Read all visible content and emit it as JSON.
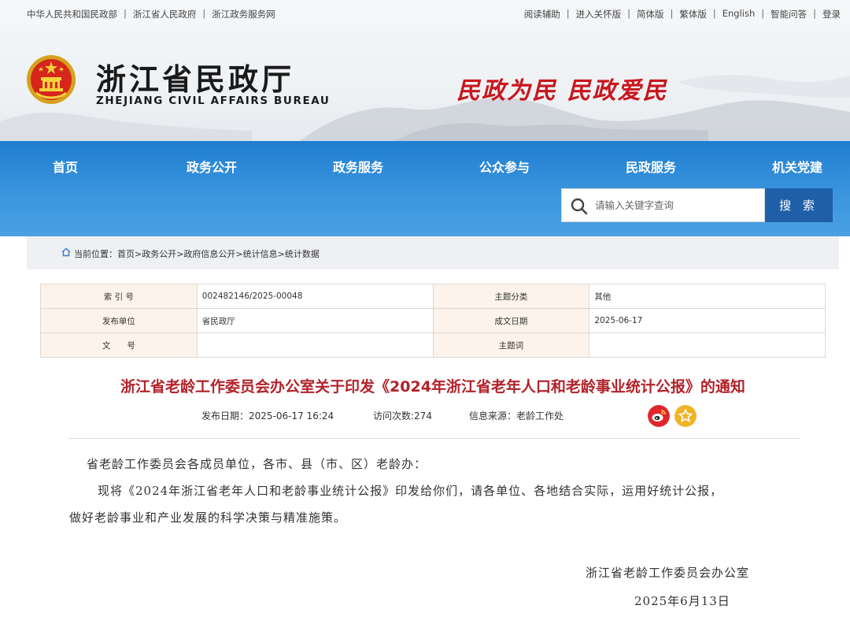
{
  "topbar": {
    "left_links": [
      "中华人民共和国民政部",
      "浙江省人民政府",
      "浙江政务服务网"
    ],
    "right_links": [
      "阅读辅助",
      "进入关怀版",
      "简体版",
      "繁体版",
      "English",
      "智能问答",
      "登录"
    ]
  },
  "header": {
    "title": "浙江省民政厅",
    "subtitle": "ZHEJIANG CIVIL AFFAIRS BUREAU",
    "slogan": "民政为民  民政爱民"
  },
  "nav": {
    "items": [
      "首页",
      "政务公开",
      "政务服务",
      "公众参与",
      "民政服务",
      "机关党建"
    ]
  },
  "search": {
    "placeholder": "请输入关键字查询",
    "button_label": "搜 索"
  },
  "breadcrumb": {
    "prefix": "当前位置：",
    "path": "首页>政务公开>政府信息公开>统计信息>统计数据"
  },
  "meta": {
    "rows": [
      {
        "k1": "索 引 号",
        "v1": "002482146/2025-00048",
        "k2": "主题分类",
        "v2": "其他"
      },
      {
        "k1": "发布单位",
        "v1": "省民政厅",
        "k2": "成文日期",
        "v2": "2025-06-17"
      },
      {
        "k1": "文　　号",
        "v1": "",
        "k2": "主题词",
        "v2": ""
      }
    ]
  },
  "article": {
    "title": "浙江省老龄工作委员会办公室关于印发《2024年浙江省老年人口和老龄事业统计公报》的通知",
    "publish_date": "发布日期：2025-06-17 16:24",
    "visits": "访问次数:274",
    "source": "信息来源：老龄工作处",
    "salutation": "省老龄工作委员会各成员单位，各市、县（市、区）老龄办：",
    "para1_line1": "现将《2024年浙江省老年人口和老龄事业统计公报》印发给你们，请各单位、各地结合实际，运用好统计公报，",
    "para1_line2": "做好老龄事业和产业发展的科学决策与精准施策。",
    "signature": "浙江省老龄工作委员会办公室",
    "sign_date": "2025年6月13日"
  },
  "icons": {
    "weibo": "weibo-icon",
    "favorite": "star-icon",
    "search": "search-icon",
    "home": "home-icon"
  },
  "colors": {
    "nav_blue": "#2a86d6",
    "search_button": "#1e5fa8",
    "title_red": "#b2222a",
    "slogan_red": "#c8161d",
    "weibo_red": "#e0262b",
    "star_yellow": "#f0b323"
  }
}
